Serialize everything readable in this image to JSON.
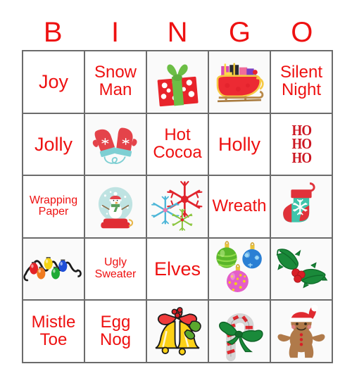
{
  "title": "Christmas BINGO Card",
  "header": {
    "letters": [
      "B",
      "I",
      "N",
      "G",
      "O"
    ]
  },
  "colors": {
    "text_red": "#ee1111",
    "hoho_red": "#cc1622",
    "grid_line": "#6b6b6b",
    "cell_bg": "#ffffff",
    "image_cell_bg": "#fafafa"
  },
  "grid": {
    "columns": 5,
    "rows": 5,
    "cells": [
      {
        "type": "text",
        "label": "Joy",
        "size": "t-lg"
      },
      {
        "type": "text",
        "label": "Snow\nMan",
        "size": "t-md"
      },
      {
        "type": "image",
        "label": "gift-box",
        "alt": "Red polka dot gift box with green ribbon and bow"
      },
      {
        "type": "image",
        "label": "sleigh",
        "alt": "Red sleigh full of colorful wrapped presents"
      },
      {
        "type": "text",
        "label": "Silent\nNight",
        "size": "t-md"
      },
      {
        "type": "text",
        "label": "Jolly",
        "size": "t-lg"
      },
      {
        "type": "image",
        "label": "mittens",
        "alt": "Pair of red mittens with snowflakes and teal cuffs"
      },
      {
        "type": "text",
        "label": "Hot\nCocoa",
        "size": "t-md"
      },
      {
        "type": "text",
        "label": "Holly",
        "size": "t-lg"
      },
      {
        "type": "hoho",
        "label": "HO\nHO\nHO"
      },
      {
        "type": "text",
        "label": "Wrapping\nPaper",
        "size": "t-sm"
      },
      {
        "type": "image",
        "label": "snow-globe",
        "alt": "Snow globe with snowman in red hat and green scarf"
      },
      {
        "type": "image",
        "label": "snowflakes",
        "alt": "Red, blue and green snowflakes"
      },
      {
        "type": "text",
        "label": "Wreath",
        "size": "t-md"
      },
      {
        "type": "image",
        "label": "stocking",
        "alt": "Teal Christmas stocking with red cuff and snowflake"
      },
      {
        "type": "image",
        "label": "string-lights",
        "alt": "String of colored Christmas lights"
      },
      {
        "type": "text",
        "label": "Ugly\nSweater",
        "size": "t-sm"
      },
      {
        "type": "text",
        "label": "Elves",
        "size": "t-lg"
      },
      {
        "type": "image",
        "label": "ornaments",
        "alt": "Three Christmas ball ornaments: green, blue and pink"
      },
      {
        "type": "image",
        "label": "holly-leaves",
        "alt": "Green holly leaves with red berries"
      },
      {
        "type": "text",
        "label": "Mistle\nToe",
        "size": "t-md"
      },
      {
        "type": "text",
        "label": "Egg\nNog",
        "size": "t-md"
      },
      {
        "type": "image",
        "label": "bells",
        "alt": "Gold bells with red bow and holly"
      },
      {
        "type": "image",
        "label": "candy-cane",
        "alt": "Candy cane with green ribbon bow"
      },
      {
        "type": "image",
        "label": "gingerbread-man",
        "alt": "Gingerbread man with Santa hat"
      }
    ]
  }
}
